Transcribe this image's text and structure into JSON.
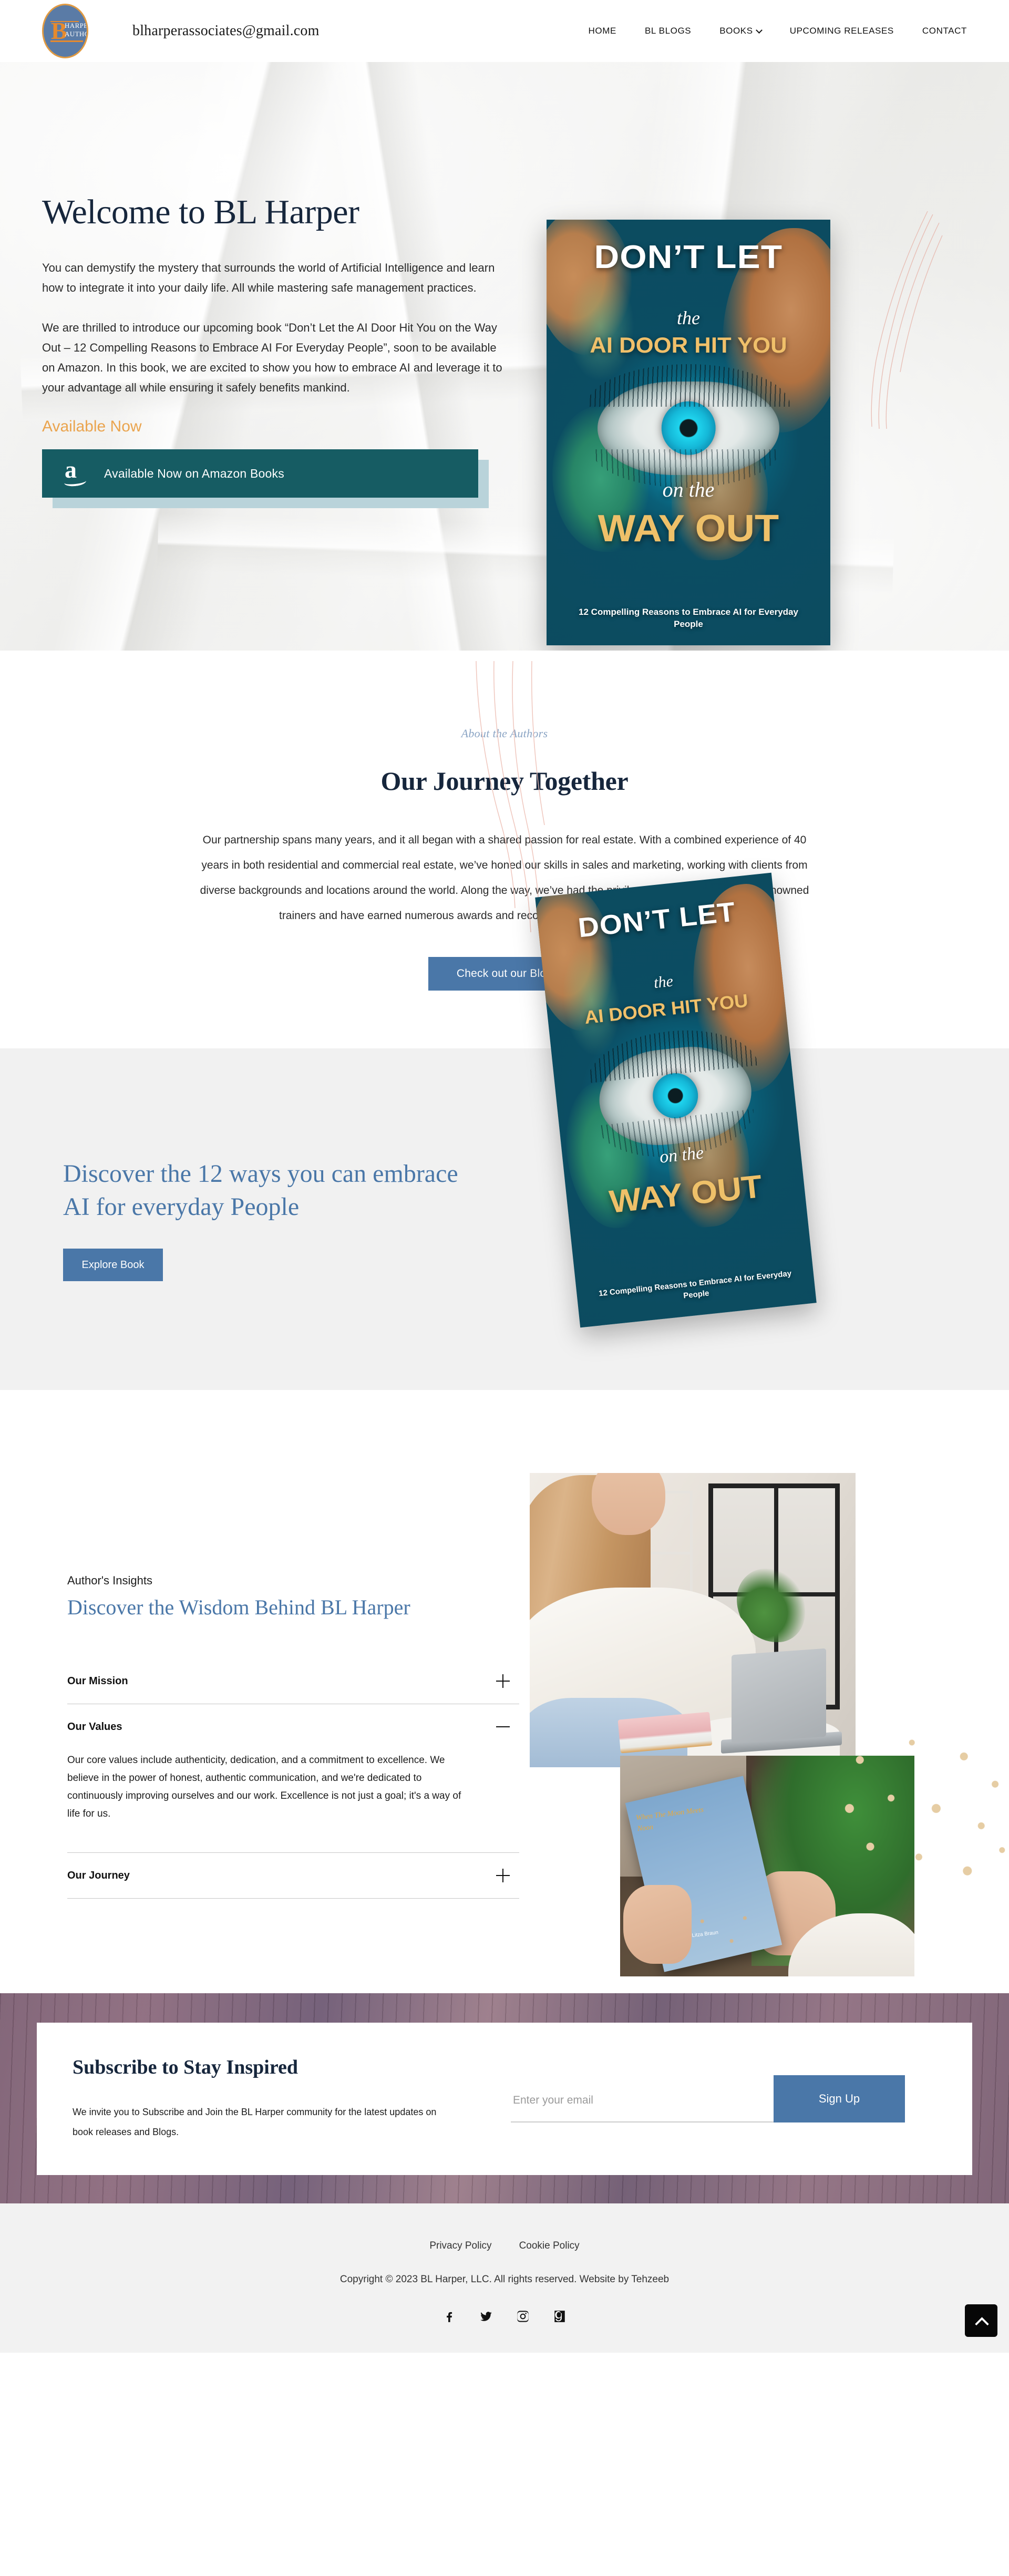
{
  "header": {
    "logo_initial": "B",
    "logo_line1": "HARPER",
    "logo_line2": "AUTHOR",
    "email": "blharperassociates@gmail.com",
    "nav": [
      {
        "label": "HOME",
        "has_caret": false
      },
      {
        "label": "BL BLOGS",
        "has_caret": false
      },
      {
        "label": "BOOKS",
        "has_caret": true
      },
      {
        "label": "UPCOMING RELEASES",
        "has_caret": false
      },
      {
        "label": "CONTACT",
        "has_caret": false
      }
    ]
  },
  "hero": {
    "title": "Welcome to BL Harper",
    "paragraph1": "You can demystify the mystery that surrounds the world of Artificial Intelligence and learn how to integrate it into your daily life. All while mastering safe management practices.",
    "paragraph2": "We are thrilled to introduce our upcoming book “Don’t Let the AI Door Hit You on the Way Out – 12 Compelling Reasons to Embrace AI For Everyday People”, soon to be available on Amazon. In this book, we are excited to show you how to embrace AI and leverage it to your advantage all while ensuring it safely benefits mankind.",
    "available_now": "Available Now",
    "amazon_button": "Available Now on Amazon Books"
  },
  "book_cover": {
    "line1": "DON’T LET",
    "line2": "the",
    "line3": "AI DOOR HIT YOU",
    "line4": "on the",
    "line5": "WAY OUT",
    "subtitle": "12 Compelling Reasons to Embrace AI for Everyday People"
  },
  "journey": {
    "eyebrow": "About the Authors",
    "title": "Our Journey Together",
    "body": "Our partnership spans many years, and it all began with a shared passion for real estate. With a combined experience of 40 years in both residential and commercial real estate, we’ve honed our skills in sales and marketing, working with clients from diverse backgrounds and locations around the world. Along the way, we’ve had the privilege of learning from world-renowned trainers and have earned numerous awards and recognition for our dedication to excellence.",
    "button": "Check out our Blog"
  },
  "discover": {
    "title": "Discover the 12 ways you can embrace AI for everyday People",
    "button": "Explore Book"
  },
  "insights": {
    "eyebrow": "Author's Insights",
    "title": "Discover the Wisdom Behind BL Harper",
    "accordion": [
      {
        "label": "Our Mission",
        "expanded": false,
        "sign": "plus",
        "body": ""
      },
      {
        "label": "Our Values",
        "expanded": true,
        "sign": "minus",
        "body": "Our core values include authenticity, dedication, and a commitment to excellence. We believe in the power of honest, authentic communication, and we're dedicated to continuously improving ourselves and our work. Excellence is not just a goal; it's a way of life for us."
      },
      {
        "label": "Our Journey",
        "expanded": false,
        "sign": "plus",
        "body": ""
      }
    ],
    "photo2_book_title": "When The Moon Meets Noon",
    "photo2_book_author": "By Litza Braun"
  },
  "subscribe": {
    "title": "Subscribe to Stay Inspired",
    "text": "We invite you to Subscribe and Join the BL Harper community for the latest updates on book releases and Blogs.",
    "email_placeholder": "Enter your email",
    "email_value": "",
    "button": "Sign Up"
  },
  "footer": {
    "links": [
      "Privacy Policy",
      "Cookie Policy"
    ],
    "copyright": "Copyright © 2023 BL Harper, LLC. All rights reserved. Website by Tehzeeb",
    "socials": [
      "facebook-icon",
      "twitter-icon",
      "instagram-icon",
      "goodreads-icon"
    ]
  },
  "colors": {
    "brand_blue": "#4a77a8",
    "deep_navy": "#16263c",
    "teal_button": "#165c63",
    "accent_orange": "#eaa44e",
    "logo_blue": "#5a7ba6",
    "logo_orange": "#e68a2e"
  }
}
